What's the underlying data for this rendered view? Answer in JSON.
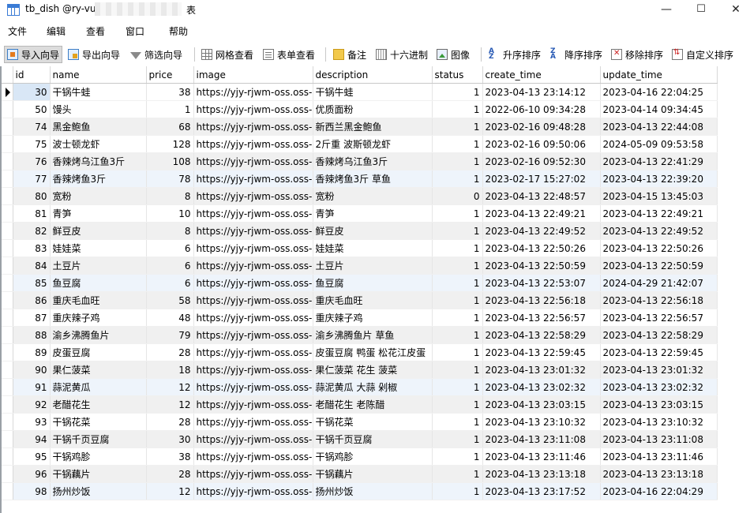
{
  "window": {
    "title": "tb_dish @ry-vue",
    "title_suffix": "表",
    "controls": {
      "minimize": "—",
      "maximize": "☐",
      "close": "✕"
    }
  },
  "menu": [
    "文件",
    "编辑",
    "查看",
    "窗口",
    "帮助"
  ],
  "toolbar": {
    "import": "导入向导",
    "export": "导出向导",
    "filter": "筛选向导",
    "grid_view": "网格查看",
    "form_view": "表单查看",
    "memo": "备注",
    "hex": "十六进制",
    "image": "图像",
    "sort_asc": "升序排序",
    "sort_desc": "降序排序",
    "remove_sort": "移除排序",
    "custom_sort": "自定义排序"
  },
  "table": {
    "columns": [
      "id",
      "name",
      "price",
      "image",
      "description",
      "status",
      "create_time",
      "update_time"
    ],
    "rows": [
      [
        "30",
        "干锅牛蛙",
        "38",
        "https://yjy-rjwm-oss.oss-c",
        "干锅牛蛙",
        "1",
        "2023-04-13 23:14:12",
        "2023-04-16 22:04:25"
      ],
      [
        "50",
        "馒头",
        "1",
        "https://yjy-rjwm-oss.oss-c",
        "优质面粉",
        "1",
        "2022-06-10 09:34:28",
        "2023-04-14 09:34:45"
      ],
      [
        "74",
        "黑金鲍鱼",
        "68",
        "https://yjy-rjwm-oss.oss-c",
        "新西兰黑金鲍鱼",
        "1",
        "2023-02-16 09:48:28",
        "2023-04-13 22:44:08"
      ],
      [
        "75",
        "波士顿龙虾",
        "128",
        "https://yjy-rjwm-oss.oss-c",
        "2斤重 波斯顿龙虾",
        "1",
        "2023-02-16 09:50:06",
        "2024-05-09 09:53:58"
      ],
      [
        "76",
        "香辣烤乌江鱼3斤",
        "108",
        "https://yjy-rjwm-oss.oss-c",
        "香辣烤乌江鱼3斤",
        "1",
        "2023-02-16 09:52:30",
        "2023-04-13 22:41:29"
      ],
      [
        "77",
        "香辣烤鱼3斤",
        "78",
        "https://yjy-rjwm-oss.oss-c",
        "香辣烤鱼3斤 草鱼",
        "1",
        "2023-02-17 15:27:02",
        "2023-04-13 22:39:20"
      ],
      [
        "80",
        "宽粉",
        "8",
        "https://yjy-rjwm-oss.oss-c",
        "宽粉",
        "0",
        "2023-04-13 22:48:57",
        "2023-04-15 13:45:03"
      ],
      [
        "81",
        "青笋",
        "10",
        "https://yjy-rjwm-oss.oss-c",
        "青笋",
        "1",
        "2023-04-13 22:49:21",
        "2023-04-13 22:49:21"
      ],
      [
        "82",
        "鲜豆皮",
        "8",
        "https://yjy-rjwm-oss.oss-c",
        "鲜豆皮",
        "1",
        "2023-04-13 22:49:52",
        "2023-04-13 22:49:52"
      ],
      [
        "83",
        "娃娃菜",
        "6",
        "https://yjy-rjwm-oss.oss-c",
        "娃娃菜",
        "1",
        "2023-04-13 22:50:26",
        "2023-04-13 22:50:26"
      ],
      [
        "84",
        "土豆片",
        "6",
        "https://yjy-rjwm-oss.oss-c",
        "土豆片",
        "1",
        "2023-04-13 22:50:59",
        "2023-04-13 22:50:59"
      ],
      [
        "85",
        "鱼豆腐",
        "6",
        "https://yjy-rjwm-oss.oss-c",
        "鱼豆腐",
        "1",
        "2023-04-13 22:53:07",
        "2024-04-29 21:42:07"
      ],
      [
        "86",
        "重庆毛血旺",
        "58",
        "https://yjy-rjwm-oss.oss-c",
        "重庆毛血旺",
        "1",
        "2023-04-13 22:56:18",
        "2023-04-13 22:56:18"
      ],
      [
        "87",
        "重庆辣子鸡",
        "48",
        "https://yjy-rjwm-oss.oss-c",
        "重庆辣子鸡",
        "1",
        "2023-04-13 22:56:57",
        "2023-04-13 22:56:57"
      ],
      [
        "88",
        "渝乡沸腾鱼片",
        "79",
        "https://yjy-rjwm-oss.oss-c",
        "渝乡沸腾鱼片 草鱼",
        "1",
        "2023-04-13 22:58:29",
        "2023-04-13 22:58:29"
      ],
      [
        "89",
        "皮蛋豆腐",
        "28",
        "https://yjy-rjwm-oss.oss-c",
        "皮蛋豆腐 鸭蛋 松花江皮蛋",
        "1",
        "2023-04-13 22:59:45",
        "2023-04-13 22:59:45"
      ],
      [
        "90",
        "果仁菠菜",
        "18",
        "https://yjy-rjwm-oss.oss-c",
        "果仁菠菜 花生 菠菜",
        "1",
        "2023-04-13 23:01:32",
        "2023-04-13 23:01:32"
      ],
      [
        "91",
        "蒜泥黄瓜",
        "12",
        "https://yjy-rjwm-oss.oss-c",
        "蒜泥黄瓜 大蒜 剁椒",
        "1",
        "2023-04-13 23:02:32",
        "2023-04-13 23:02:32"
      ],
      [
        "92",
        "老醋花生",
        "12",
        "https://yjy-rjwm-oss.oss-c",
        "老醋花生 老陈醋",
        "1",
        "2023-04-13 23:03:15",
        "2023-04-13 23:03:15"
      ],
      [
        "93",
        "干锅花菜",
        "28",
        "https://yjy-rjwm-oss.oss-c",
        "干锅花菜",
        "1",
        "2023-04-13 23:10:32",
        "2023-04-13 23:10:32"
      ],
      [
        "94",
        "干锅千页豆腐",
        "30",
        "https://yjy-rjwm-oss.oss-c",
        "干锅千页豆腐",
        "1",
        "2023-04-13 23:11:08",
        "2023-04-13 23:11:08"
      ],
      [
        "95",
        "干锅鸡胗",
        "38",
        "https://yjy-rjwm-oss.oss-c",
        "干锅鸡胗",
        "1",
        "2023-04-13 23:11:46",
        "2023-04-13 23:11:46"
      ],
      [
        "96",
        "干锅藕片",
        "28",
        "https://yjy-rjwm-oss.oss-c",
        "干锅藕片",
        "1",
        "2023-04-13 23:13:18",
        "2023-04-13 23:13:18"
      ],
      [
        "98",
        "扬州炒饭",
        "12",
        "https://yjy-rjwm-oss.oss-c",
        "扬州炒饭",
        "1",
        "2023-04-13 23:17:52",
        "2023-04-16 22:04:29"
      ]
    ]
  }
}
